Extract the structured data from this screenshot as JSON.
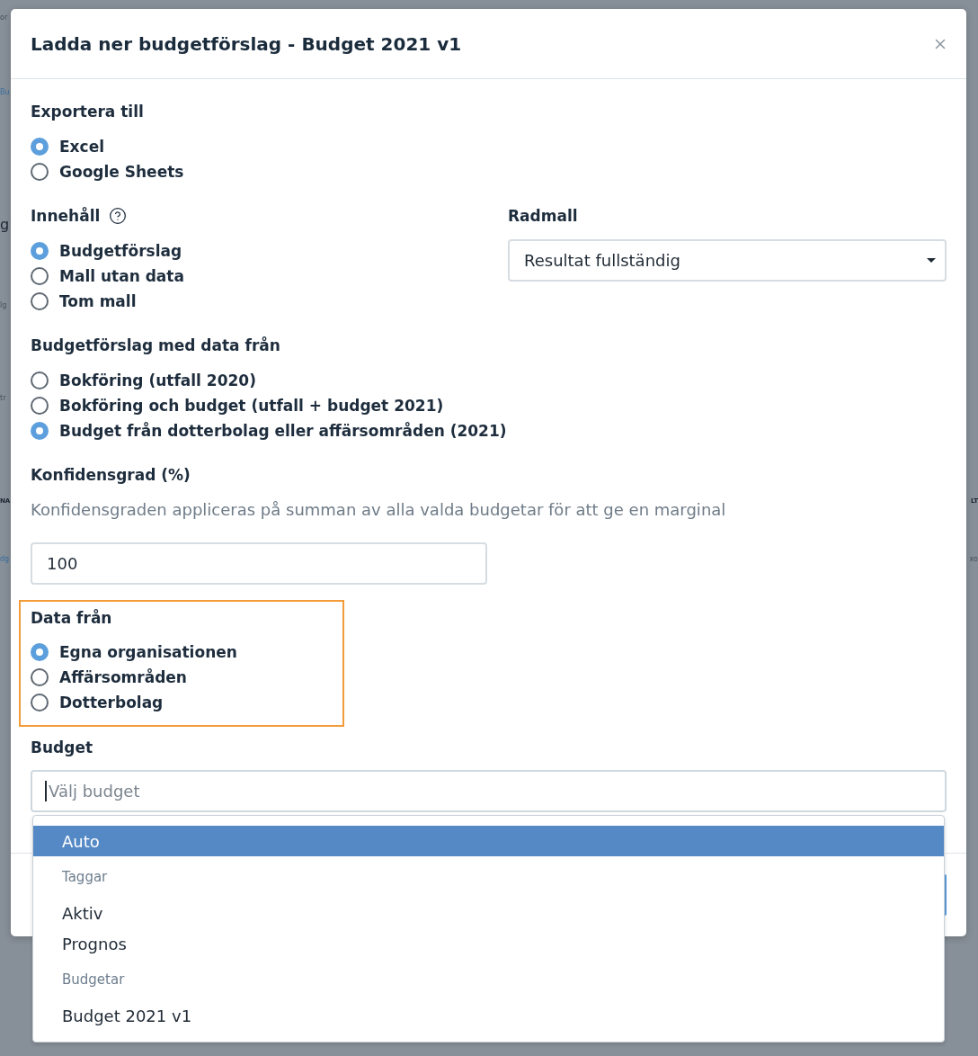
{
  "background": {
    "left": [
      {
        "text": "or",
        "kind": "text"
      },
      {
        "text": "Bu",
        "kind": "link"
      },
      {
        "text": "g",
        "kind": "heading"
      },
      {
        "text": "lg",
        "kind": "text"
      },
      {
        "text": "tr",
        "kind": "text"
      },
      {
        "text": "NA",
        "kind": "column"
      },
      {
        "text": "dg",
        "kind": "link"
      }
    ],
    "right": [
      {
        "text": "LT",
        "kind": "column"
      },
      {
        "text": "xo",
        "kind": "text"
      }
    ]
  },
  "dialog": {
    "title": "Ladda ner budgetförslag - Budget 2021 v1"
  },
  "export": {
    "label": "Exportera till",
    "options": [
      {
        "label": "Excel",
        "selected": true
      },
      {
        "label": "Google Sheets",
        "selected": false
      }
    ]
  },
  "content": {
    "label": "Innehåll",
    "options": [
      {
        "label": "Budgetförslag",
        "selected": true
      },
      {
        "label": "Mall utan data",
        "selected": false
      },
      {
        "label": "Tom mall",
        "selected": false
      }
    ]
  },
  "row_template": {
    "label": "Radmall",
    "value": "Resultat fullständig"
  },
  "source": {
    "label": "Budgetförslag med data från",
    "options": [
      {
        "label": "Bokföring (utfall 2020)",
        "selected": false
      },
      {
        "label": "Bokföring och budget (utfall + budget 2021)",
        "selected": false
      },
      {
        "label": "Budget från dotterbolag eller affärsområden (2021)",
        "selected": true
      }
    ]
  },
  "confidence": {
    "label": "Konfidensgrad (%)",
    "help": "Konfidensgraden appliceras på summan av alla valda budgetar för att ge en marginal",
    "value": "100"
  },
  "data_from": {
    "label": "Data från",
    "highlighted": true,
    "options": [
      {
        "label": "Egna organisationen",
        "selected": true
      },
      {
        "label": "Affärsområden",
        "selected": false
      },
      {
        "label": "Dotterbolag",
        "selected": false
      }
    ]
  },
  "budget": {
    "label": "Budget",
    "placeholder": "Välj budget",
    "focused": true,
    "expanded": true,
    "menu": [
      {
        "kind": "option",
        "label": "Auto",
        "selected": true
      },
      {
        "kind": "group",
        "label": "Taggar"
      },
      {
        "kind": "option",
        "label": "Aktiv",
        "selected": false
      },
      {
        "kind": "option",
        "label": "Prognos",
        "selected": false
      },
      {
        "kind": "group",
        "label": "Budgetar"
      },
      {
        "kind": "option",
        "label": "Budget 2021 v1",
        "selected": false
      }
    ]
  }
}
